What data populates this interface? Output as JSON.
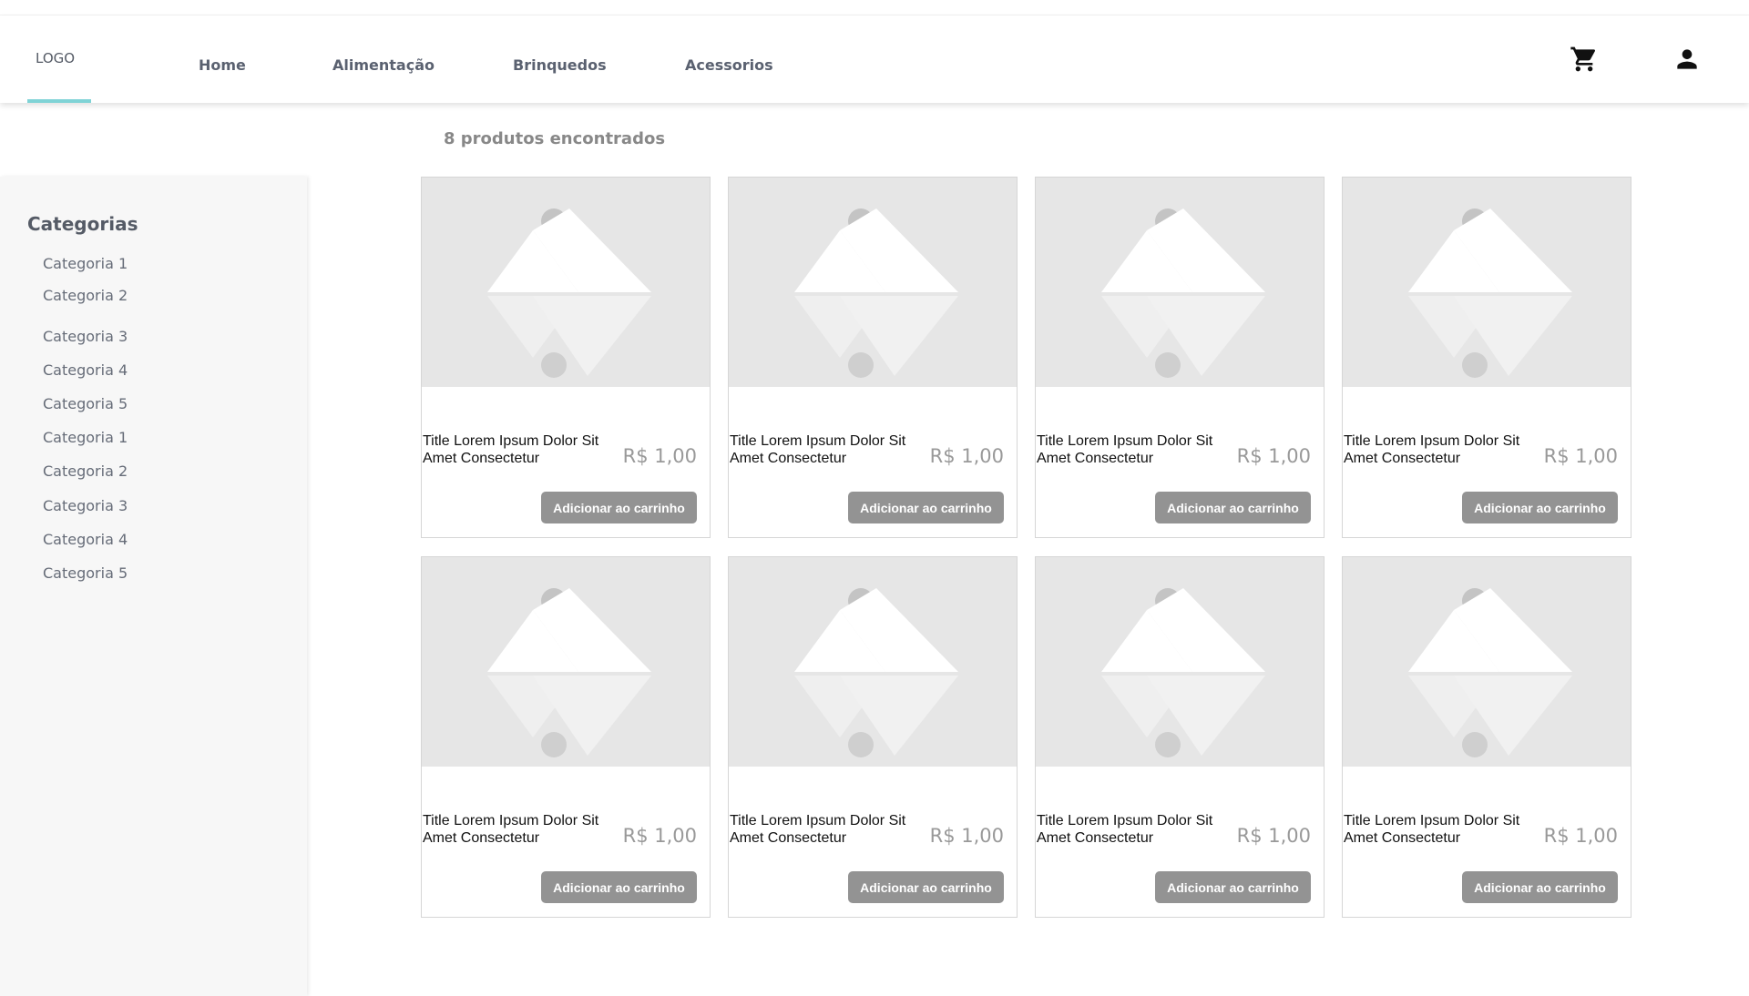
{
  "header": {
    "logo": "LOGO",
    "nav": [
      "Home",
      "Alimentação",
      "Brinquedos",
      "Acessorios"
    ],
    "icons": [
      "cart-icon",
      "user-icon"
    ]
  },
  "results_text": "8 produtos encontrados",
  "sidebar": {
    "title": "Categorias",
    "items": [
      "Categoria 1",
      "Categoria 2",
      "Categoria 3",
      "Categoria 4",
      "Categoria 5",
      "Categoria 1",
      "Categoria 2",
      "Categoria 3",
      "Categoria 4",
      "Categoria 5"
    ]
  },
  "products": [
    {
      "title": "Title Lorem Ipsum Dolor Sit Amet Consectetur",
      "price": "R$ 1,00",
      "button": "Adicionar ao carrinho"
    },
    {
      "title": "Title Lorem Ipsum Dolor Sit Amet Consectetur",
      "price": "R$ 1,00",
      "button": "Adicionar ao carrinho"
    },
    {
      "title": "Title Lorem Ipsum Dolor Sit Amet Consectetur",
      "price": "R$ 1,00",
      "button": "Adicionar ao carrinho"
    },
    {
      "title": "Title Lorem Ipsum Dolor Sit Amet Consectetur",
      "price": "R$ 1,00",
      "button": "Adicionar ao carrinho"
    },
    {
      "title": "Title Lorem Ipsum Dolor Sit Amet Consectetur",
      "price": "R$ 1,00",
      "button": "Adicionar ao carrinho"
    },
    {
      "title": "Title Lorem Ipsum Dolor Sit Amet Consectetur",
      "price": "R$ 1,00",
      "button": "Adicionar ao carrinho"
    },
    {
      "title": "Title Lorem Ipsum Dolor Sit Amet Consectetur",
      "price": "R$ 1,00",
      "button": "Adicionar ao carrinho"
    },
    {
      "title": "Title Lorem Ipsum Dolor Sit Amet Consectetur",
      "price": "R$ 1,00",
      "button": "Adicionar ao carrinho"
    }
  ],
  "colors": {
    "accent": "#7fd3d6",
    "button": "#939393",
    "placeholder": "#e6e6e6"
  }
}
